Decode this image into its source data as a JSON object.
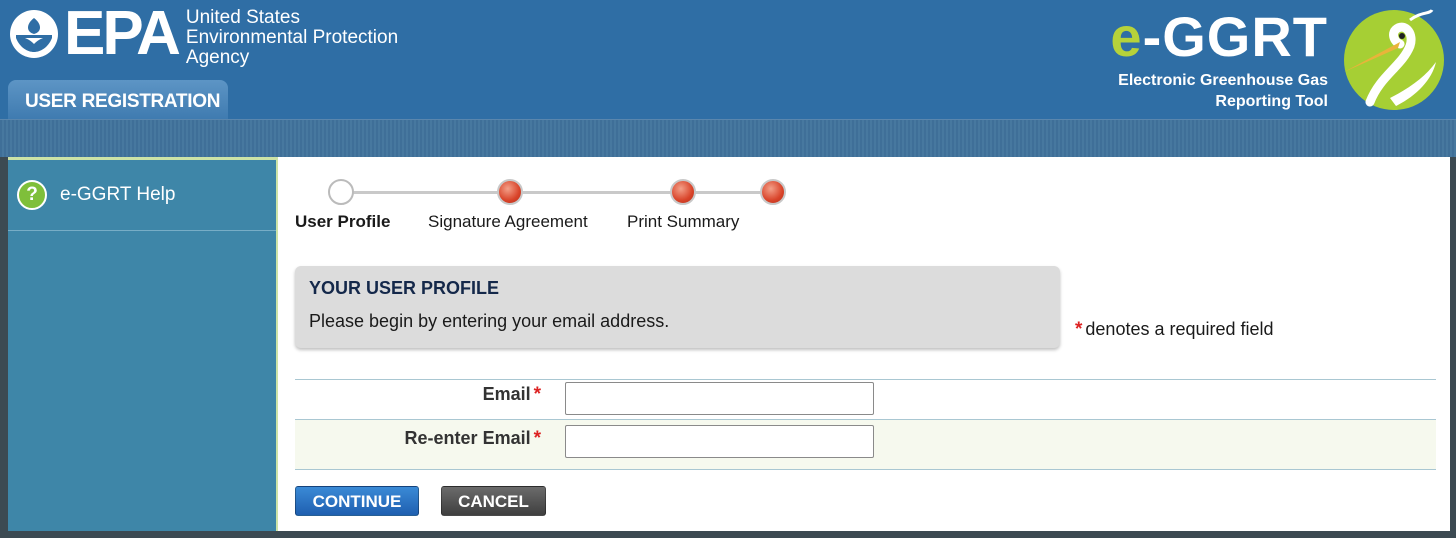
{
  "header": {
    "epa_wordmark": "EPA",
    "agency_lines": [
      "United States",
      "Environmental Protection",
      "Agency"
    ],
    "tab_label": "USER REGISTRATION",
    "tool_name_prefix": "e",
    "tool_name_rest": "-GGRT",
    "tool_subtitle_lines": [
      "Electronic Greenhouse Gas",
      "Reporting Tool"
    ]
  },
  "sidebar": {
    "items": [
      {
        "label": "e-GGRT Help",
        "icon": "help-question-icon"
      }
    ]
  },
  "steps": [
    {
      "label": "User Profile",
      "state": "current"
    },
    {
      "label": "Signature Agreement",
      "state": "pending"
    },
    {
      "label": "Print Summary",
      "state": "pending"
    }
  ],
  "profile": {
    "title": "YOUR USER PROFILE",
    "description": "Please begin by entering your email address."
  },
  "required_note": "denotes a required field",
  "form": {
    "email_label": "Email",
    "email_value": "",
    "reenter_label": "Re-enter Email",
    "reenter_value": ""
  },
  "buttons": {
    "continue": "CONTINUE",
    "cancel": "CANCEL"
  },
  "colors": {
    "header_blue": "#2f6ea5",
    "sidebar_blue": "#3e86a8",
    "required_red": "#d22222",
    "continue_blue": "#1f5fb0",
    "brand_green": "#b6d23a"
  }
}
